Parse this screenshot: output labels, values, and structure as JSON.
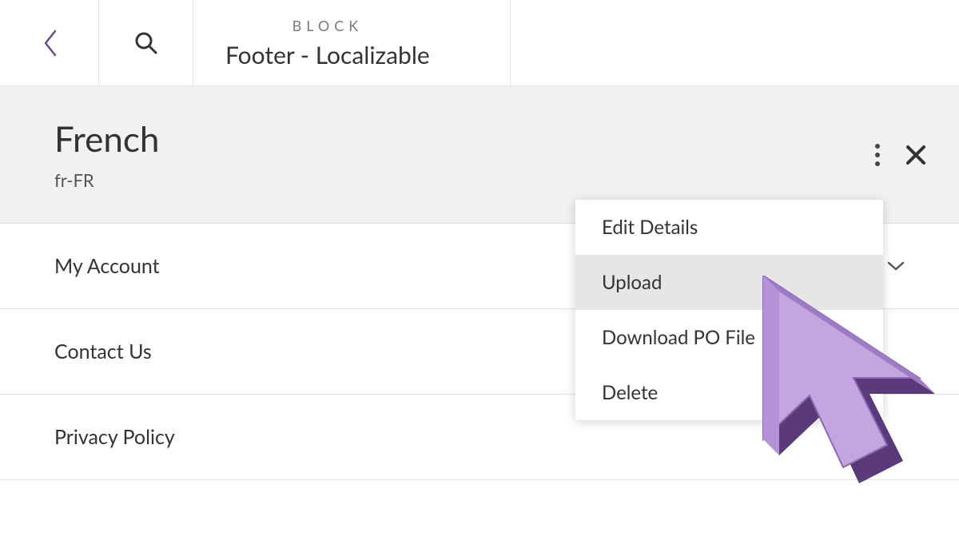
{
  "header": {
    "label": "BLOCK",
    "title": "Footer - Localizable"
  },
  "panel": {
    "lang_name": "French",
    "lang_code": "fr-FR"
  },
  "items": [
    {
      "label": "My Account"
    },
    {
      "label": "Contact Us"
    },
    {
      "label": "Privacy Policy"
    }
  ],
  "menu": [
    {
      "label": "Edit Details",
      "highlighted": false
    },
    {
      "label": "Upload",
      "highlighted": true
    },
    {
      "label": "Download PO File",
      "highlighted": false
    },
    {
      "label": "Delete",
      "highlighted": false
    }
  ]
}
